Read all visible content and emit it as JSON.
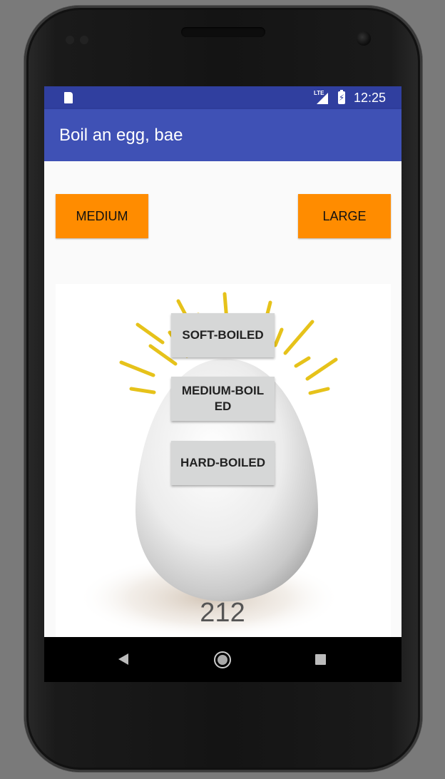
{
  "status_bar": {
    "network_label": "LTE",
    "time": "12:25",
    "icons": [
      "sd-card-icon",
      "signal-icon",
      "battery-charging-icon"
    ]
  },
  "app_bar": {
    "title": "Boil an egg, bae"
  },
  "size_buttons": {
    "medium_label": "MEDIUM",
    "large_label": "LARGE"
  },
  "boil_buttons": {
    "soft_label": "SOFT-BOILED",
    "medium_label": "MEDIUM-BOIL\nED",
    "hard_label": "HARD-BOILED"
  },
  "timer": {
    "value": "212"
  },
  "nav_bar": {
    "icons": [
      "back-icon",
      "home-icon",
      "recent-apps-icon"
    ]
  },
  "colors": {
    "status_bar": "#303f9f",
    "app_bar": "#3f51b5",
    "size_button": "#ff8c00",
    "boil_button": "#d6d7d7",
    "sun_rays": "#e6c21a"
  }
}
